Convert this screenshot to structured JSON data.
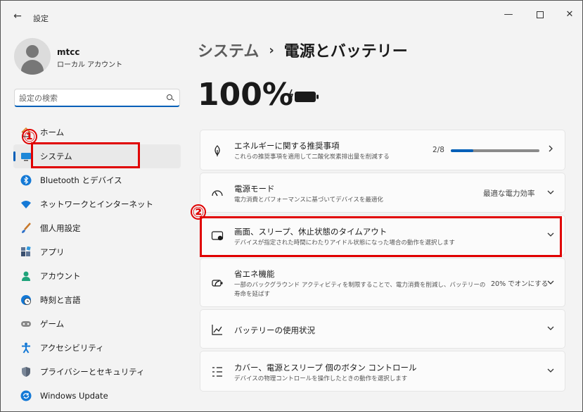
{
  "window": {
    "title": "設定",
    "back_glyph": "←",
    "minimize_glyph": "—",
    "close_glyph": "✕"
  },
  "user": {
    "name": "mtcc",
    "account_type": "ローカル アカウント"
  },
  "search": {
    "placeholder": "設定の検索",
    "value": ""
  },
  "sidebar": {
    "items": [
      {
        "label": "ホーム",
        "icon": "home-icon"
      },
      {
        "label": "システム",
        "icon": "system-icon",
        "active": true
      },
      {
        "label": "Bluetooth とデバイス",
        "icon": "bluetooth-icon"
      },
      {
        "label": "ネットワークとインターネット",
        "icon": "wifi-icon"
      },
      {
        "label": "個人用設定",
        "icon": "brush-icon"
      },
      {
        "label": "アプリ",
        "icon": "apps-icon"
      },
      {
        "label": "アカウント",
        "icon": "account-icon"
      },
      {
        "label": "時刻と言語",
        "icon": "globe-clock-icon"
      },
      {
        "label": "ゲーム",
        "icon": "gamepad-icon"
      },
      {
        "label": "アクセシビリティ",
        "icon": "accessibility-icon"
      },
      {
        "label": "プライバシーとセキュリティ",
        "icon": "shield-icon"
      },
      {
        "label": "Windows Update",
        "icon": "update-icon"
      }
    ]
  },
  "breadcrumb": {
    "parent": "システム",
    "separator": "›",
    "current": "電源とバッテリー"
  },
  "battery": {
    "percent_label": "100%",
    "charging": true
  },
  "cards": {
    "energy": {
      "title": "エネルギーに関する推奨事項",
      "subtitle": "これらの推奨事項を適用して二酸化炭素排出量を削減する",
      "progress_label": "2/8",
      "progress_fraction": 0.25
    },
    "power_mode": {
      "title": "電源モード",
      "subtitle": "電力消費とパフォーマンスに基づいてデバイスを最適化",
      "value": "最適な電力効率"
    },
    "screen_sleep": {
      "title": "画面、スリープ、休止状態のタイムアウト",
      "subtitle": "デバイスが指定された時間にわたりアイドル状態になった場合の動作を選択します"
    },
    "energy_saver": {
      "title": "省エネ機能",
      "subtitle_line1": "一部のバックグラウンド アクティビティを制限することで、電力消費を削減し、バッテリーの",
      "subtitle_line2": "寿命を延ばす",
      "value": "20% でオンにする"
    },
    "battery_usage": {
      "title": "バッテリーの使用状況"
    },
    "buttons": {
      "title": "カバー、電源とスリープ 個のボタン コントロール",
      "subtitle": "デバイスの物理コントロールを操作したときの動作を選択します"
    }
  },
  "annotations": {
    "one": "①",
    "two": "②",
    "color": "#e00000"
  },
  "colors": {
    "accent": "#005fb8",
    "annotation": "#e00000"
  }
}
